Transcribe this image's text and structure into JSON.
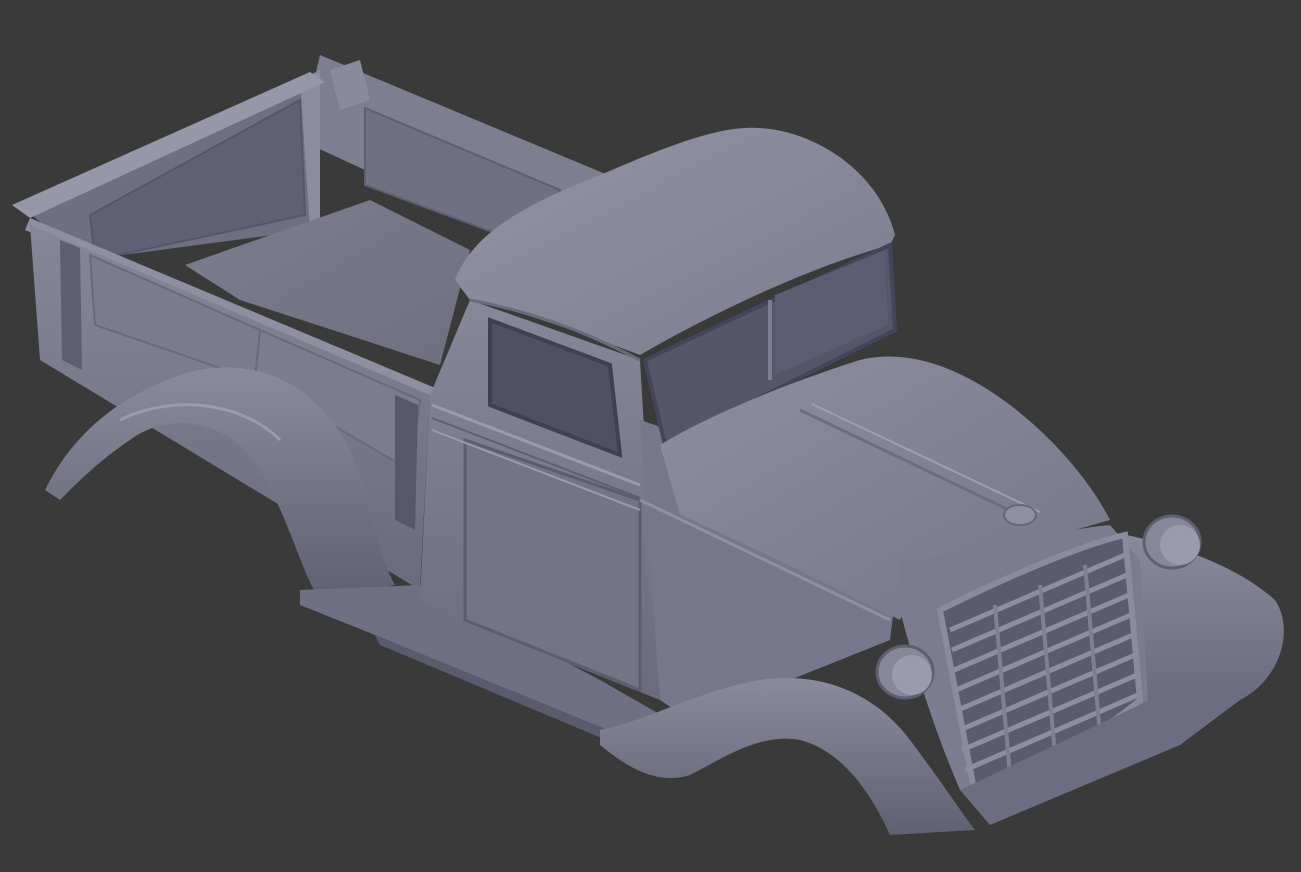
{
  "scene": {
    "background_color": "#3a3a3a",
    "model_color": "#7a7b8c",
    "model_shadow_color": "#5a5b6a",
    "model_dark_color": "#4a4b5a",
    "model_highlight_color": "#9596a8",
    "window_color": "#4f5064"
  }
}
